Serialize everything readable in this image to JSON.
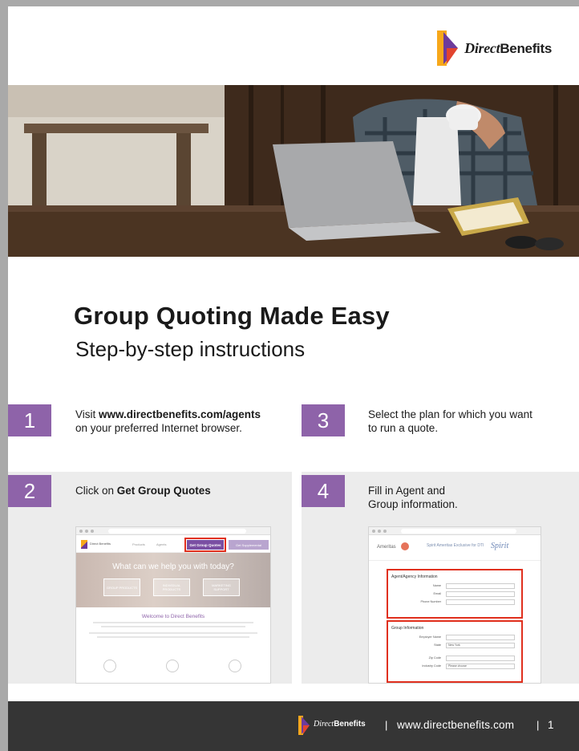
{
  "brand": {
    "name_italic": "Direct",
    "name_bold": "Benefits"
  },
  "title": "Group Quoting Made Easy",
  "subtitle": "Step-by-step instructions",
  "steps": [
    {
      "number": "1",
      "text_pre": "Visit ",
      "text_bold": "www.directbenefits.com/agents",
      "text_post": "on your preferred Internet browser."
    },
    {
      "number": "2",
      "text_pre": "Click on ",
      "text_bold": "Get Group Quotes",
      "text_post": ""
    },
    {
      "number": "3",
      "text_line1": "Select the plan for which you want",
      "text_line2": "to run a quote."
    },
    {
      "number": "4",
      "text_line1": "Fill in Agent and",
      "text_line2": "Group information."
    }
  ],
  "screen1": {
    "nav_items": [
      "Direct Benefits",
      "Products",
      "Agents"
    ],
    "get_group_quotes": "Get Group Quotes",
    "secondary_button": "Get Supplemental",
    "hero_text": "What can we help you with today?",
    "hero_boxes": [
      "GROUP PRODUCTS",
      "INDIVIDUAL PRODUCTS",
      "MARKETING SUPPORT"
    ],
    "welcome": "Welcome to Direct Benefits"
  },
  "screen2": {
    "carrier": "Ameritas",
    "program": "Spirit Ameritas Exclusive for DTI",
    "program_logo": "Spirit",
    "agent_section": "Agent/Agency Information",
    "agent_fields": [
      "Name",
      "Email",
      "Phone Number"
    ],
    "group_section": "Group Information",
    "group_fields": [
      "Employer Name",
      "State",
      "Zip Code",
      "Industry Code"
    ],
    "state_value": "New York",
    "industry_value": "Please choose"
  },
  "footer": {
    "separator": "|",
    "url": "www.directbenefits.com",
    "page": "1"
  },
  "colors": {
    "accent_purple": "#8e63a9",
    "logo_orange": "#f7a81b",
    "logo_purple": "#6d3b9c",
    "logo_red": "#e2442f",
    "highlight_red": "#e0301e",
    "footer_bg": "#353535"
  }
}
